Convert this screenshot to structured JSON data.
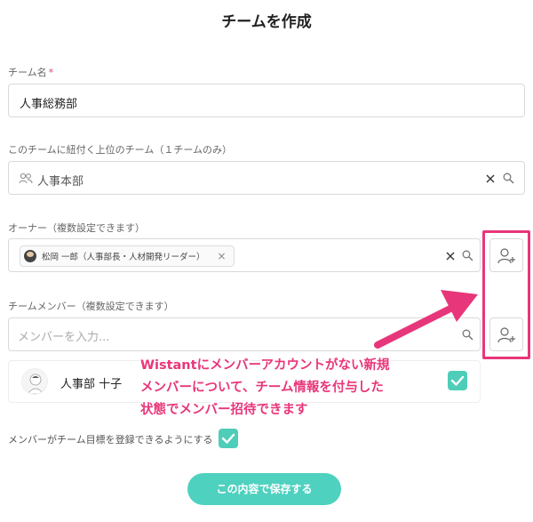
{
  "page": {
    "title": "チームを作成"
  },
  "team_name": {
    "label": "チーム名",
    "required_mark": "*",
    "value": "人事総務部"
  },
  "parent_team": {
    "label": "このチームに紐付く上位のチーム（１チームのみ）",
    "value": "人事本部"
  },
  "owner": {
    "label": "オーナー（複数設定できます）",
    "chip_text": "松岡 一郎（人事部長・人材開発リーダー）",
    "chip_remove": "×",
    "clear": "×"
  },
  "members": {
    "label": "チームメンバー（複数設定できます）",
    "placeholder": "メンバーを入力...",
    "items": [
      {
        "name": "人事部 十子",
        "checked": true
      }
    ]
  },
  "register_goal": {
    "label": "メンバーがチーム目標を登録できるようにする",
    "checked": true
  },
  "save_button": {
    "label": "この内容で保存する"
  },
  "annotation": {
    "lines": [
      "Wistantにメンバーアカウントがない新規",
      "メンバーについて、チーム情報を付与した",
      "状態でメンバー招待できます"
    ]
  },
  "colors": {
    "accent": "#4fd1bf",
    "annotation": "#e8367a",
    "required": "#e0417c"
  },
  "icons": [
    "search-icon",
    "clear-icon",
    "group-icon",
    "add-user-icon",
    "check-icon",
    "arrow"
  ]
}
